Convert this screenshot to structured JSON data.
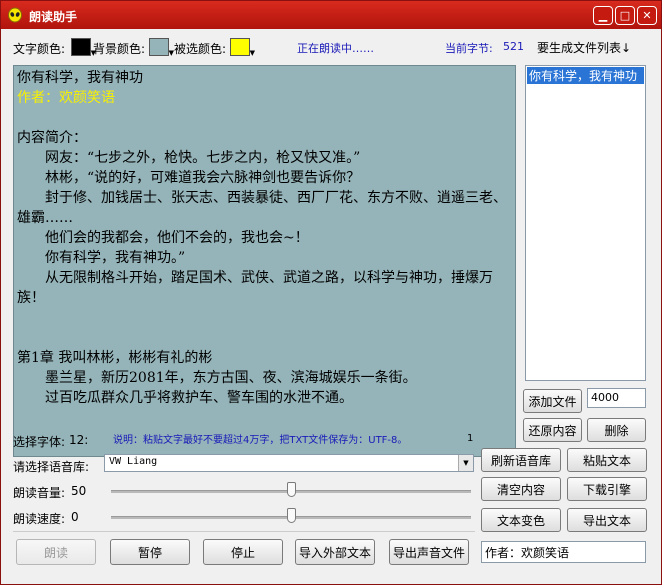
{
  "window": {
    "title": "朗读助手",
    "controls": [
      "minimize-icon",
      "maximize-icon",
      "close-icon"
    ]
  },
  "toolbar": {
    "text_color_label": "文字颜色:",
    "bg_color_label": "背景颜色:",
    "sel_color_label": "被选颜色:",
    "status": "正在朗读中……",
    "current_char_label": "当前字节:",
    "current_char_value": "521",
    "file_list_dropdown": "要生成文件列表↓",
    "colors": {
      "text": "#000000",
      "background": "#95b4b9",
      "selected": "#ffff00",
      "accent_title": "#c4170e"
    }
  },
  "editor": {
    "lines": [
      "你有科学，我有神功",
      "作者：欢颜笑语",
      "",
      "内容简介：",
      "　　网友：“七步之外，枪快。七步之内，枪又快又准。”",
      "　　林彬，“说的好，可难道我会六脉神剑也要告诉你？",
      "　　封于修、加钱居士、张天志、西装暴徒、西厂厂花、东方不败、逍遥三老、雄霸……",
      "　　他们会的我都会，他们不会的，我也会~！",
      "　　你有科学，我有神功。”",
      "　　从无限制格斗开始，踏足国术、武侠、武道之路，以科学与神功，捶爆万族！",
      "",
      "",
      "第1章 我叫林彬，彬彬有礼的彬",
      "　　墨兰星，新历2081年，东方古国、夜、滨海城娱乐一条街。",
      "　　过百吃瓜群众几乎将救护车、警车围的水泄不通。"
    ]
  },
  "file_list": {
    "items": [
      "你有科学，我有神功"
    ]
  },
  "right_panel": {
    "add_file": "添加文件",
    "max_chars_value": "4000",
    "restore": "还原内容",
    "delete": "删除",
    "refresh_voices": "刷新语音库",
    "paste_text": "粘贴文本",
    "clear": "清空内容",
    "download_engine": "下载引擎",
    "text_color_change": "文本变色",
    "export_text": "导出文本",
    "author_value": "作者：欢颜笑语"
  },
  "settings": {
    "font_label": "选择字体:",
    "font_size": "12:",
    "hint": "说明：粘贴文字最好不要超过4万字，把TXT文件保存为：UTF-8。",
    "hint_count": "1",
    "voice_label": "请选择语音库:",
    "voice_value": "VW Liang",
    "volume_label": "朗读音量:",
    "volume_value": "50",
    "volume_level": 0.5,
    "speed_label": "朗读速度:",
    "speed_value": "0",
    "speed_level": 0.5
  },
  "bottom_buttons": {
    "read": "朗读",
    "pause": "暂停",
    "stop": "停止",
    "import": "导入外部文本",
    "export_audio": "导出声音文件"
  }
}
